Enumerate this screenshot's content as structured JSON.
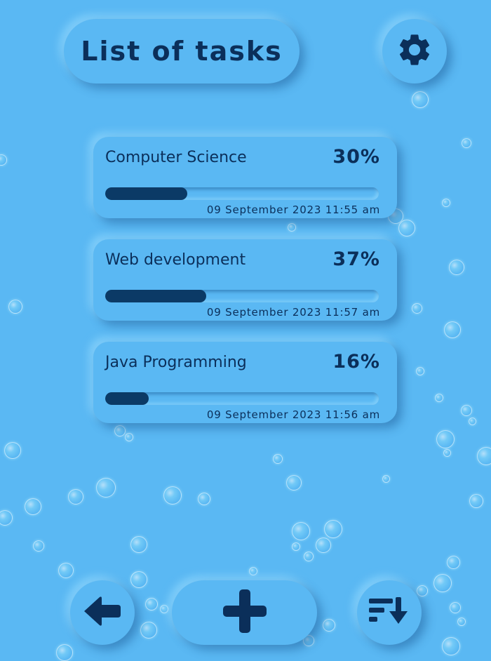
{
  "header": {
    "title": "List of tasks",
    "settings_icon": "gear-icon"
  },
  "tasks": [
    {
      "name": "Computer Science",
      "percent": "30%",
      "progress": 30,
      "date": "09 September 2023 11:55 am"
    },
    {
      "name": "Web development",
      "percent": "37%",
      "progress": 37,
      "date": "09 September 2023 11:57 am"
    },
    {
      "name": "Java Programming",
      "percent": "16%",
      "progress": 16,
      "date": "09 September 2023 11:56 am"
    }
  ],
  "footer": {
    "back_icon": "arrow-left-icon",
    "add_icon": "plus-icon",
    "sort_icon": "sort-down-icon"
  },
  "colors": {
    "background": "#5ab8f3",
    "accent": "#0b2f5a",
    "progress_fill": "#0b3a66"
  }
}
